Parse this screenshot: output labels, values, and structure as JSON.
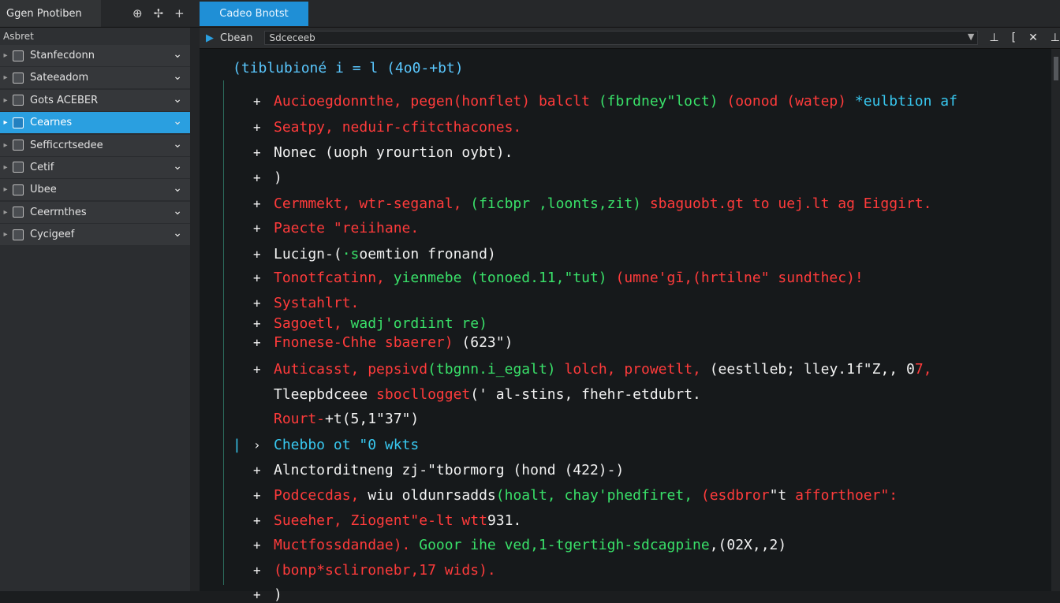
{
  "topbar": {
    "app_tab": "Ggen Pnotiben",
    "icons": [
      "gear-icon",
      "pin-icon",
      "plus-icon"
    ],
    "editor_tab": "Cadeo Bnotst"
  },
  "sidebar": {
    "header": "Asbret",
    "items": [
      {
        "label": "Stanfecdonn",
        "icon": "file-icon",
        "active": false
      },
      {
        "label": "Sateeadom",
        "icon": "file-icon",
        "active": false
      },
      {
        "label": "Gots ACEBER",
        "icon": "folder-icon",
        "active": false
      },
      {
        "label": "Cearnes",
        "icon": "chart-icon",
        "active": true
      },
      {
        "label": "Sefficcrtsedee",
        "icon": "file-icon",
        "active": false
      },
      {
        "label": "Cetif",
        "icon": "file-icon",
        "active": false
      },
      {
        "label": "Ubee",
        "icon": "file-icon",
        "active": false
      },
      {
        "label": "Ceerrnthes",
        "icon": "chart-icon",
        "active": false
      },
      {
        "label": "Cycigeef",
        "icon": "pencil-icon",
        "active": false
      }
    ]
  },
  "editor_bar": {
    "open_label": "Cbean",
    "path": "Sdceceeb",
    "icons": [
      "pin-icon",
      "bracket-icon",
      "close-icon",
      "pin-icon"
    ]
  },
  "code": {
    "header": "(tiblubioné i = l (4o0-+bt)",
    "lines": [
      {
        "segments": [
          {
            "t": "Aucioegdonnthe, pegen(honflet) balclt ",
            "c": "red"
          },
          {
            "t": "(fbrdney\"loct)",
            "c": "green"
          },
          {
            "t": " (oonod (watep)",
            "c": "red"
          },
          {
            "t": " *eulbtion af",
            "c": "cyan"
          }
        ]
      },
      {
        "segments": [
          {
            "t": "Seatpy, neduir-cfitcthacones.",
            "c": "red"
          }
        ]
      },
      {
        "segments": [
          {
            "t": "Nonec (uoph yrourtion oybt).",
            "c": "white"
          }
        ]
      },
      {
        "segments": [
          {
            "t": ")",
            "c": "white"
          }
        ]
      },
      {
        "segments": [
          {
            "t": "Cermmekt, wtr-seganal, ",
            "c": "red"
          },
          {
            "t": "(ficbpr ,loonts,zit)",
            "c": "green"
          },
          {
            "t": " sbaguobt.gt to uej.lt ag Eiggirt.",
            "c": "red"
          }
        ]
      },
      {
        "segments": [
          {
            "t": "Paecte \"reiihane.",
            "c": "red"
          }
        ]
      },
      {
        "segments": [
          {
            "t": "Lucign-(",
            "c": "white"
          },
          {
            "t": "·s",
            "c": "green"
          },
          {
            "t": "oemtion fronand)",
            "c": "white"
          }
        ]
      },
      {
        "segments": [
          {
            "t": "Tonotfcatinn, ",
            "c": "red"
          },
          {
            "t": "yienmebe (tonoed.11,\"tut)",
            "c": "green"
          },
          {
            "t": " (umne'gī,(hrtilne\" sundthec)!",
            "c": "red"
          }
        ]
      },
      {
        "segments": [
          {
            "t": "Systahlrt.",
            "c": "red"
          }
        ]
      },
      {
        "segments": [
          {
            "t": "Sagoetl, ",
            "c": "red"
          },
          {
            "t": "wadj'ordiint re)",
            "c": "green"
          }
        ]
      },
      {
        "segments": [
          {
            "t": "Fnonese-Chhe sbaerer)",
            "c": "red"
          },
          {
            "t": " (623\")",
            "c": "white"
          }
        ]
      },
      {
        "segments": [
          {
            "t": "Auticasst, pepsivd",
            "c": "red"
          },
          {
            "t": "(tbgnn.i_egalt)",
            "c": "green"
          },
          {
            "t": " lolch, prowetlt,",
            "c": "red"
          },
          {
            "t": " (eestlleb;",
            "c": "white"
          },
          {
            "t": " lley.1f\"Z,, 0",
            "c": "white"
          },
          {
            "t": "7,",
            "c": "red"
          }
        ]
      },
      {
        "segments": [
          {
            "t": "Tleepbdceee ",
            "c": "white"
          },
          {
            "t": "sbocllogget",
            "c": "red"
          },
          {
            "t": "(' al-stins, fhehr-etdubrt.",
            "c": "white"
          }
        ]
      },
      {
        "segments": [
          {
            "t": "Rourt-",
            "c": "red"
          },
          {
            "t": "+t(5,1\"37\")",
            "c": "white"
          }
        ]
      },
      {
        "segments": [
          {
            "t": "Chebbo ot \"0 wkts",
            "c": "cyan"
          }
        ]
      },
      {
        "segments": [
          {
            "t": "Alnctorditneng zj-\"tbormorg (hond (422)-)",
            "c": "white"
          }
        ]
      },
      {
        "segments": [
          {
            "t": "Podcecdas, ",
            "c": "red"
          },
          {
            "t": "wiu oldunrsadds",
            "c": "white"
          },
          {
            "t": "(hoalt, chay'phedfiret,",
            "c": "green"
          },
          {
            "t": " (esdbror",
            "c": "red"
          },
          {
            "t": "\"t",
            "c": "white"
          },
          {
            "t": " afforthoer\":",
            "c": "red"
          }
        ]
      },
      {
        "segments": [
          {
            "t": "Sueeher, Ziogent\"e-lt wtt",
            "c": "red"
          },
          {
            "t": "931.",
            "c": "white"
          }
        ]
      },
      {
        "segments": [
          {
            "t": "Muctfossdandae).",
            "c": "red"
          },
          {
            "t": " Gooor ihe ved,1-tgertigh-sdcagpine",
            "c": "green"
          },
          {
            "t": ",(02X,,2)",
            "c": "white"
          }
        ]
      },
      {
        "segments": [
          {
            "t": "(bonp",
            "c": "red"
          },
          {
            "t": "*sclironebr,17 wids).",
            "c": "red"
          }
        ]
      },
      {
        "segments": [
          {
            "t": ")",
            "c": "white"
          }
        ]
      }
    ]
  },
  "colors": {
    "accent": "#2a9fe0",
    "red": "#ff3b3b",
    "green": "#39e069",
    "cyan": "#38c8f0"
  }
}
